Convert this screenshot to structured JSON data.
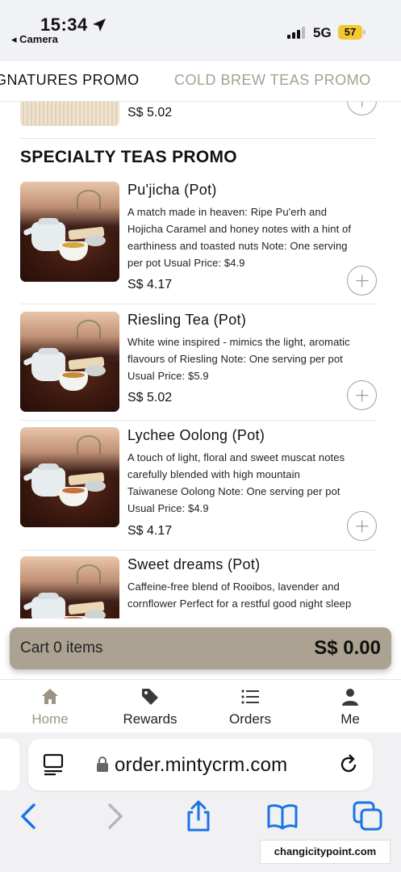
{
  "status_bar": {
    "time": "15:34",
    "back_app": "◂ Camera",
    "network": "5G",
    "battery": "57"
  },
  "category_tabs": [
    {
      "label": "GNATURES PROMO",
      "active": true
    },
    {
      "label": "COLD BREW TEAS PROMO",
      "active": false
    }
  ],
  "partial_item": {
    "price": "S$ 5.02"
  },
  "section": {
    "title": "SPECIALTY TEAS PROMO"
  },
  "items": [
    {
      "name": "Pu'jicha (Pot)",
      "desc_lines": [
        "A match made in heaven: Ripe Pu'erh and",
        "Hojicha Caramel and honey notes with a hint of",
        "earthiness and toasted nuts  Note: One serving",
        "per pot Usual Price: $4.9"
      ],
      "price": "S$ 4.17"
    },
    {
      "name": "Riesling Tea (Pot)",
      "desc_lines": [
        "White wine inspired - mimics the light, aromatic",
        "flavours of Riesling  Note: One serving per pot",
        "Usual Price: $5.9"
      ],
      "price": "S$ 5.02"
    },
    {
      "name": "Lychee Oolong (Pot)",
      "desc_lines": [
        "A touch of light, floral and sweet muscat notes",
        "carefully blended with high mountain",
        "Taiwanese Oolong  Note: One serving per pot",
        "Usual Price: $4.9"
      ],
      "price": "S$ 4.17"
    },
    {
      "name": "Sweet dreams (Pot)",
      "desc_lines": [
        "Caffeine-free blend of Rooibos, lavender and",
        "cornflower Perfect for a restful good night sleep"
      ],
      "price": ""
    }
  ],
  "cart": {
    "label": "Cart 0 items",
    "total": "S$ 0.00"
  },
  "bottom_nav": [
    {
      "label": "Home",
      "icon": "home-icon"
    },
    {
      "label": "Rewards",
      "icon": "tag-icon"
    },
    {
      "label": "Orders",
      "icon": "list-icon"
    },
    {
      "label": "Me",
      "icon": "person-icon"
    }
  ],
  "browser": {
    "url": "order.mintycrm.com"
  },
  "watermark": "changicitypoint.com",
  "colors": {
    "accent": "#aba291",
    "tab_inactive": "#a89f90",
    "ios_blue": "#1a73e8",
    "battery": "#f3c72f"
  }
}
